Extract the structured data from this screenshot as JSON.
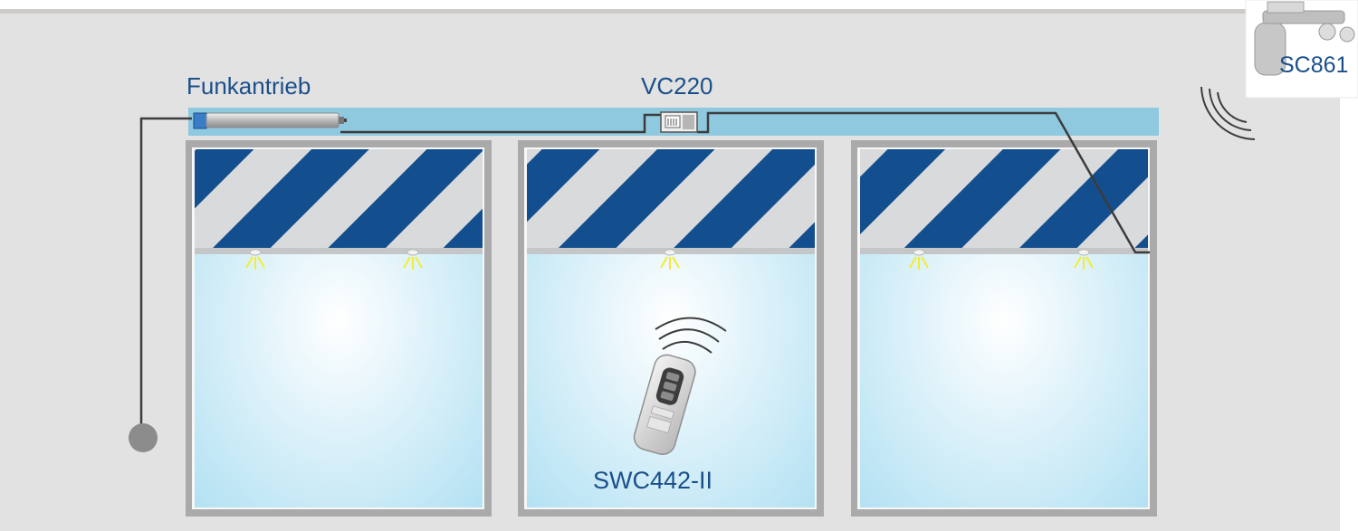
{
  "labels": {
    "motor": "Funkantrieb",
    "controller": "VC220",
    "sensor": "SC861",
    "remote": "SWC442-II"
  },
  "colors": {
    "wall": "#e2e2e2",
    "wall_top": "#cfcbc8",
    "rail": "#8ec9df",
    "stripe_blue": "#134f8e",
    "stripe_light": "#d9dadc",
    "glass_center": "#ffffff",
    "glass_edge": "#b5e2f3",
    "frame": "#aaaaaa",
    "cable": "#3c3c3c",
    "label": "#1b4f8a",
    "led": "#f3ee2c"
  },
  "icons": [
    "motor-icon",
    "controller-box-icon",
    "weather-sensor-icon",
    "remote-control-icon",
    "radio-wave-icon",
    "led-light-icon",
    "ground-contact-icon"
  ]
}
